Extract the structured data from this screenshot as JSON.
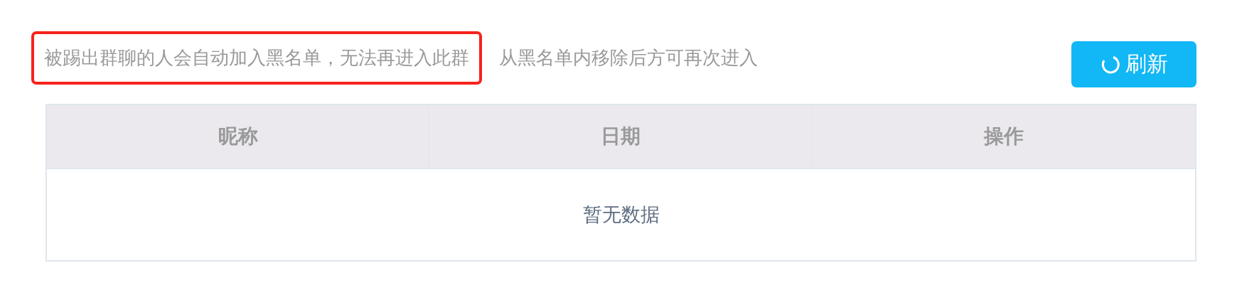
{
  "notice": [
    {
      "text": "被踢出群聊的人会自动加入黑名单，无法再进入此群",
      "highlighted": true
    },
    {
      "text": "从黑名单内移除后方可再次进入",
      "highlighted": false
    }
  ],
  "refresh_button": {
    "label": "刷新"
  },
  "table": {
    "columns": [
      "昵称",
      "日期",
      "操作"
    ],
    "empty_text": "暂无数据"
  }
}
